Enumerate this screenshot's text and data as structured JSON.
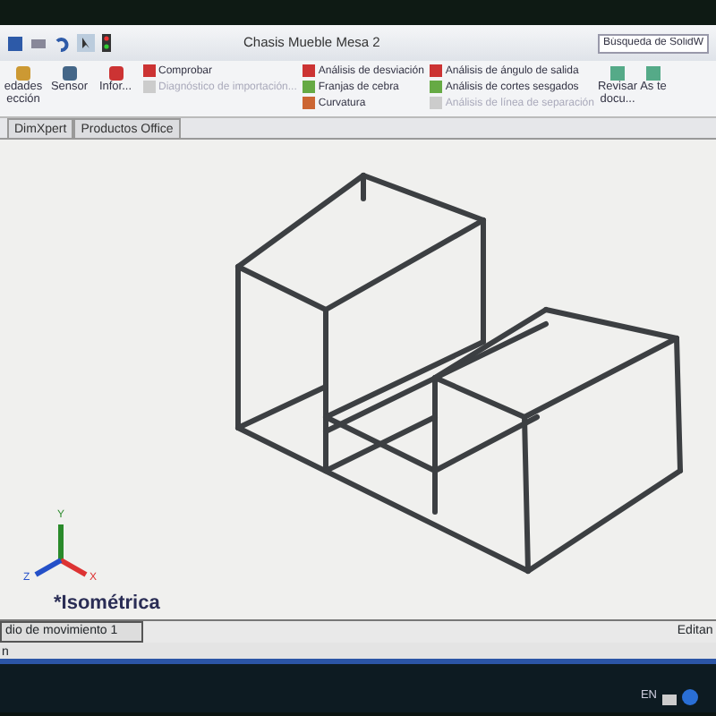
{
  "window": {
    "title": "Chasis Mueble Mesa 2"
  },
  "search": {
    "placeholder": "Búsqueda de SolidW"
  },
  "ribbon": {
    "large_buttons": [
      {
        "label": "edades ección"
      },
      {
        "label": "Sensor"
      },
      {
        "label": "Infor..."
      }
    ],
    "commands": [
      {
        "label": "Comprobar",
        "disabled": false
      },
      {
        "label": "Diagnóstico de importación...",
        "disabled": true
      }
    ],
    "analysis_left": [
      {
        "label": "Análisis de desviación",
        "disabled": false
      },
      {
        "label": "Franjas de cebra",
        "disabled": false
      },
      {
        "label": "Curvatura",
        "disabled": false
      }
    ],
    "analysis_right": [
      {
        "label": "Análisis de ángulo de salida",
        "disabled": false
      },
      {
        "label": "Análisis de cortes sesgados",
        "disabled": false
      },
      {
        "label": "Análisis de línea de separación",
        "disabled": true
      }
    ],
    "right_buttons": [
      {
        "label": "Revisar docu..."
      },
      {
        "label": "As te"
      }
    ]
  },
  "tabs": [
    {
      "label": "DimXpert",
      "selected": false
    },
    {
      "label": "Productos Office",
      "selected": false
    }
  ],
  "viewport": {
    "view_name": "*Isométrica",
    "axes": [
      "X",
      "Y",
      "Z"
    ]
  },
  "status_bar": {
    "tab": "dio de movimiento 1",
    "state": "Editan",
    "line": "n"
  },
  "taskbar": {
    "language": "EN"
  }
}
